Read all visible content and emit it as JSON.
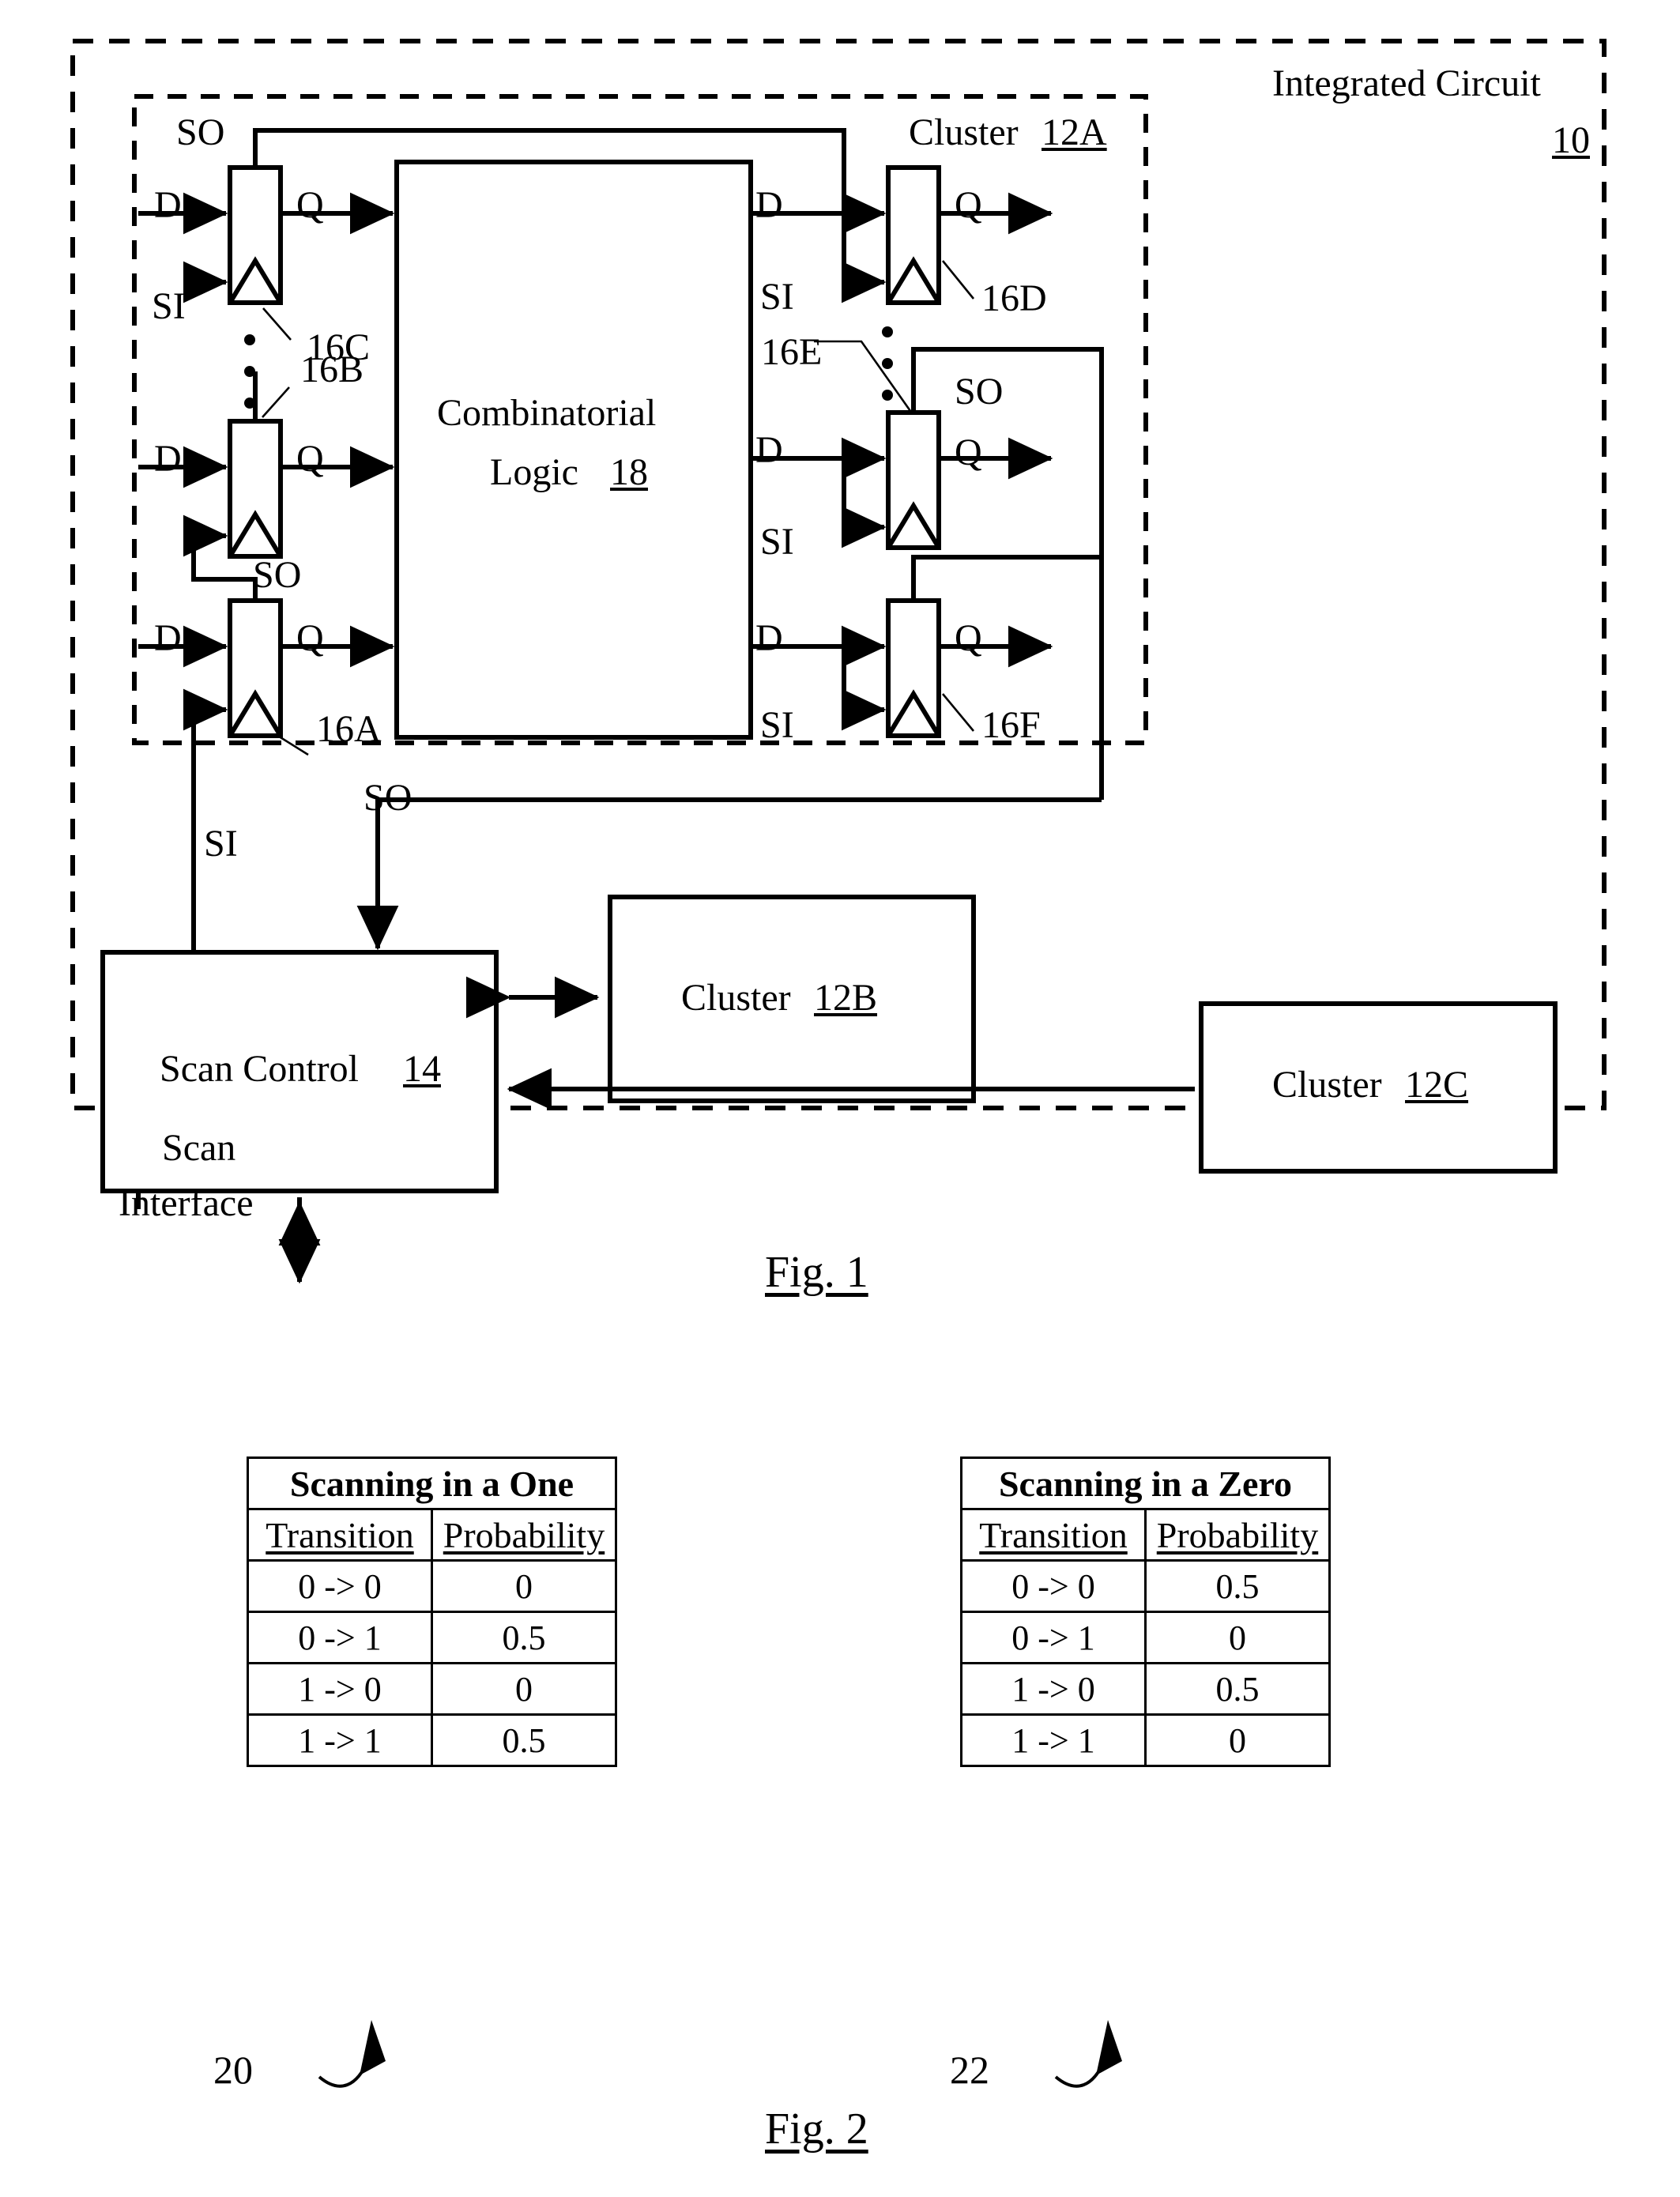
{
  "figure1": {
    "caption": "Fig. 1",
    "outer_label": "Integrated Circuit",
    "outer_ref": "10",
    "cluster_a_label": "Cluster",
    "cluster_a_ref": "12A",
    "logic_line1": "Combinatorial",
    "logic_line2": "Logic",
    "logic_ref": "18",
    "scan_control_label": "Scan Control",
    "scan_control_ref": "14",
    "cluster_b_label": "Cluster",
    "cluster_b_ref": "12B",
    "cluster_c_label": "Cluster",
    "cluster_c_ref": "12C",
    "scan_interface_line1": "Scan",
    "scan_interface_line2": "Interface",
    "flipflop_refs": [
      "16A",
      "16B",
      "16C",
      "16D",
      "16E",
      "16F"
    ],
    "pins": {
      "d": "D",
      "q": "Q",
      "si": "SI",
      "so": "SO"
    },
    "signal_labels": {
      "so_top_left": "SO",
      "so_mid_left": "SO",
      "so_mid_right": "SO",
      "so_bottom": "SO",
      "si_bottom": "SI"
    },
    "ellipsis": "⋮"
  },
  "figure2": {
    "caption": "Fig. 2",
    "table_left": {
      "ref": "20",
      "title": "Scanning in a One",
      "columns": [
        "Transition",
        "Probability"
      ],
      "rows": [
        {
          "transition": "0 -> 0",
          "probability": "0"
        },
        {
          "transition": "0 -> 1",
          "probability": "0.5"
        },
        {
          "transition": "1 -> 0",
          "probability": "0"
        },
        {
          "transition": "1 -> 1",
          "probability": "0.5"
        }
      ]
    },
    "table_right": {
      "ref": "22",
      "title": "Scanning in a Zero",
      "columns": [
        "Transition",
        "Probability"
      ],
      "rows": [
        {
          "transition": "0 -> 0",
          "probability": "0.5"
        },
        {
          "transition": "0 -> 1",
          "probability": "0"
        },
        {
          "transition": "1 -> 0",
          "probability": "0.5"
        },
        {
          "transition": "1 -> 1",
          "probability": "0"
        }
      ]
    }
  }
}
